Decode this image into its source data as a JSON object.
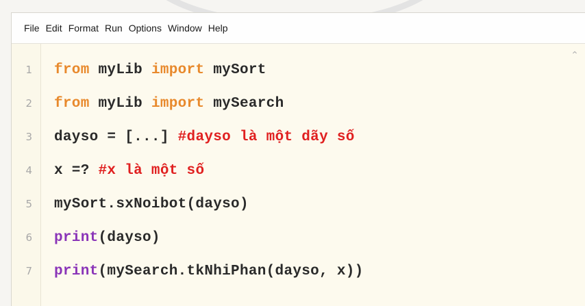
{
  "menu": [
    "File",
    "Edit",
    "Format",
    "Run",
    "Options",
    "Window",
    "Help"
  ],
  "editor": {
    "lines": [
      {
        "num": "1",
        "tokens": [
          {
            "t": "from",
            "c": "kw"
          },
          {
            "t": " myLib ",
            "c": ""
          },
          {
            "t": "import",
            "c": "kw"
          },
          {
            "t": " mySort",
            "c": ""
          }
        ]
      },
      {
        "num": "2",
        "tokens": [
          {
            "t": "from",
            "c": "kw"
          },
          {
            "t": " myLib ",
            "c": ""
          },
          {
            "t": "import",
            "c": "kw"
          },
          {
            "t": " mySearch",
            "c": ""
          }
        ]
      },
      {
        "num": "3",
        "tokens": [
          {
            "t": "dayso = [...] ",
            "c": ""
          },
          {
            "t": "#dayso là một dãy số",
            "c": "cm"
          }
        ]
      },
      {
        "num": "4",
        "tokens": [
          {
            "t": "x =? ",
            "c": ""
          },
          {
            "t": "#x là một số",
            "c": "cm"
          }
        ]
      },
      {
        "num": "5",
        "tokens": [
          {
            "t": "mySort.sxNoibot(dayso)",
            "c": ""
          }
        ]
      },
      {
        "num": "6",
        "tokens": [
          {
            "t": "print",
            "c": "fn"
          },
          {
            "t": "(dayso)",
            "c": ""
          }
        ]
      },
      {
        "num": "7",
        "tokens": [
          {
            "t": "print",
            "c": "fn"
          },
          {
            "t": "(mySearch.tkNhiPhan(dayso, x))",
            "c": ""
          }
        ]
      }
    ]
  },
  "icons": {
    "scroll_up": "chevron-up-icon"
  }
}
